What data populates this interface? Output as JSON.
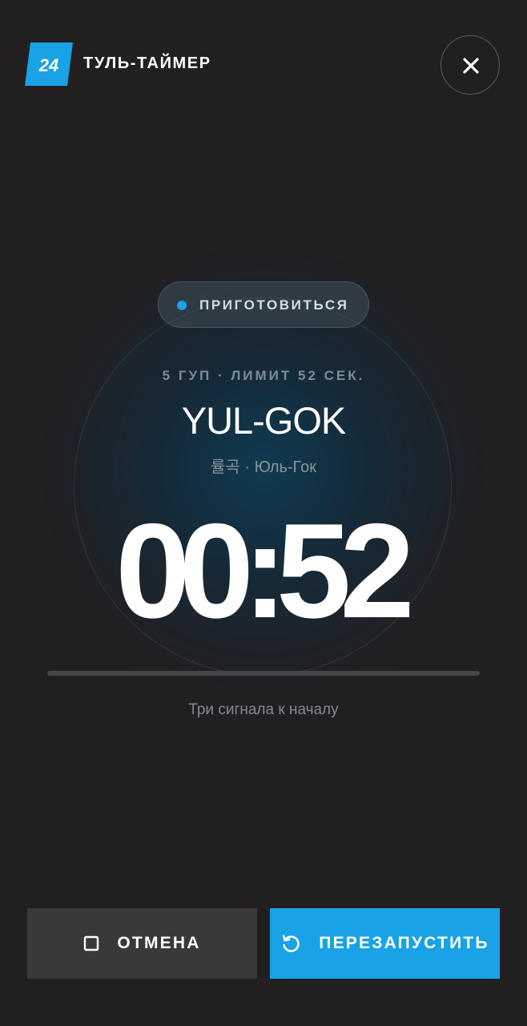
{
  "header": {
    "logo_text": "24",
    "app_title": "ТУЛЬ-ТАЙМЕР",
    "close_icon": "close-icon"
  },
  "status": {
    "label": "ПРИГОТОВИТЬСЯ",
    "dot_color": "#1aa3e8"
  },
  "pattern": {
    "meta": "5 ГУП · ЛИМИТ 52 СЕК.",
    "name": "YUL-GOK",
    "translit": "률곡 · Юль-Гок"
  },
  "timer": {
    "display": "00:52",
    "progress_fraction": 0
  },
  "hint": "Три сигнала к началу",
  "actions": {
    "cancel_label": "ОТМЕНА",
    "cancel_icon": "stop-square-icon",
    "restart_label": "ПЕРЕЗАПУСТИТЬ",
    "restart_icon": "restart-icon"
  },
  "colors": {
    "accent": "#19a2e6",
    "background": "#221f20",
    "secondary_button": "#3a3839"
  }
}
